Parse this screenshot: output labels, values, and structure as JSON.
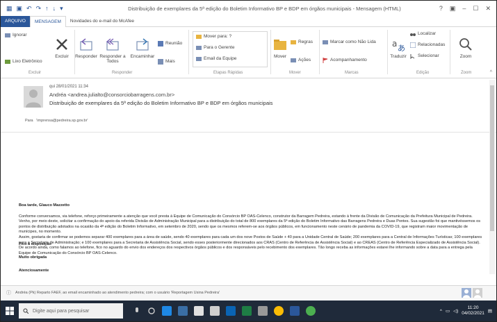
{
  "window": {
    "title": "Distribuição de exemplares da 5ª edição do Boletim Informativo BP e BDP em órgãos municipais - Mensagem (HTML)",
    "controls": [
      "?",
      "▣",
      "–",
      "☐",
      "✕"
    ]
  },
  "ribbon_tabs": [
    {
      "label": "ARQUIVO"
    },
    {
      "label": "MENSAGEM"
    },
    {
      "label": "Novidades do e-mail do McAfee"
    }
  ],
  "ribbon": {
    "excluir": {
      "ignorar": "Ignorar",
      "lixo": "Lixo Eletrônico",
      "excluir": "Excluir",
      "group": "Excluir"
    },
    "responder": {
      "responder": "Responder",
      "responder_todos": "Responder a Todos",
      "encaminhar": "Encaminhar",
      "reuniao": "Reunião",
      "mais": "Mais",
      "group": "Responder"
    },
    "etapas": {
      "items": [
        "Mover para: ?",
        "Para o Gerente",
        "Email da Equipe"
      ],
      "group": "Etapas Rápidas"
    },
    "mover": {
      "mover": "Mover",
      "regras": "Regras",
      "acoes": "Ações",
      "group": "Mover"
    },
    "marcas": {
      "marcar": "Marcar como Não Lida",
      "acompanhamento": "Acompanhamento",
      "group": "Marcas"
    },
    "edicao": {
      "traduzir": "Traduzir",
      "localizar": "Localizar",
      "relacionadas": "Relacionadas",
      "selecionar": "Selecionar",
      "group": "Edição"
    },
    "zoom": {
      "zoom": "Zoom",
      "group": "Zoom"
    }
  },
  "message": {
    "date": "qui 28/01/2021 11:34",
    "sender": "Andréa <andrea.julialto@consorciobarragens.com.br>",
    "subject": "Distribuição de exemplares da 5ª edição do Boletim Informativo BP e BDP em órgãos municipais",
    "to_label": "Para",
    "to_value": "'imprensa@pedreira.sp.gov.br'"
  },
  "body": {
    "greeting": "Boa tarde, Glauco Mazzetto",
    "p1": "Conforme conversamos, via telefone, reforço primeiramente a atenção que você presta à Equipe de Comunicação do Consórcio BP OAS-Celenco, construtor da Barragem Pedreira, estando à frente da Divisão de Comunicação da Prefeitura Municipal de Pedreira.",
    "p2": "Venho, por meio deste, solicitar a confirmação do apoio da referida Divisão de Administração Municipal para a distribuição do total de 800 exemplares da 5ª edição do Boletim Informativo das Barragens Pedreira e Duas Pontes. Sua sugestão foi que mantivéssemos os pontos de distribuição adotados na ocasião da 4ª edição do Boletim Informativo, em setembro de 2020, sendo que os mesmos referem-se aos órgãos públicos, em funcionamento neste cenário de pandemia da COVID-19, que registram maior movimentação de munícipes, no momento.",
    "p3": "Assim, gostaria de confirmar se podemos separar 400 exemplares para a área de saúde, sendo 40 exemplares para cada um dos nove Postos de Saúde + 40 para a Unidade Central de Saúde; 200 exemplares para a Central de Informações Turísticas; 100 exemplares para a Secretaria de Administração; e 100 exemplares para a Secretaria de Assistência Social, sendo esses posteriormente direcionados aos CRAS (Centro de Referência de Assistência Social) e ao CREAS (Centro de Referência Especializado de Assistência Social).",
    "p4": "De acordo ainda, como falamos ao telefone, fico no aguardo do envio dos endereços dos respectivos órgãos públicos e dos responsáveis pelo recebimento dos exemplares. Tão longo receba as informações estarei lhe informando sobre a data para a entrega pela Equipe de Comunicação do Consórcio BP OAS-Celenco.",
    "c1": "Fico à disposição",
    "c2": "Muito obrigada",
    "c3": "Atenciosamente"
  },
  "people_pane": {
    "text": "Andréa  (Pk) Reparto FAEF, ao email encaminhado ao atendimento pedreira; com o usuário 'Reportagem Usina Pedreira'"
  },
  "taskbar": {
    "search_placeholder": "Digite aqui para pesquisar",
    "time": "11:20",
    "date": "04/02/2021"
  },
  "colors": {
    "accent": "#2b579a",
    "taskbar": "#1f2a3a",
    "ribbon_active": "#2b579a"
  }
}
